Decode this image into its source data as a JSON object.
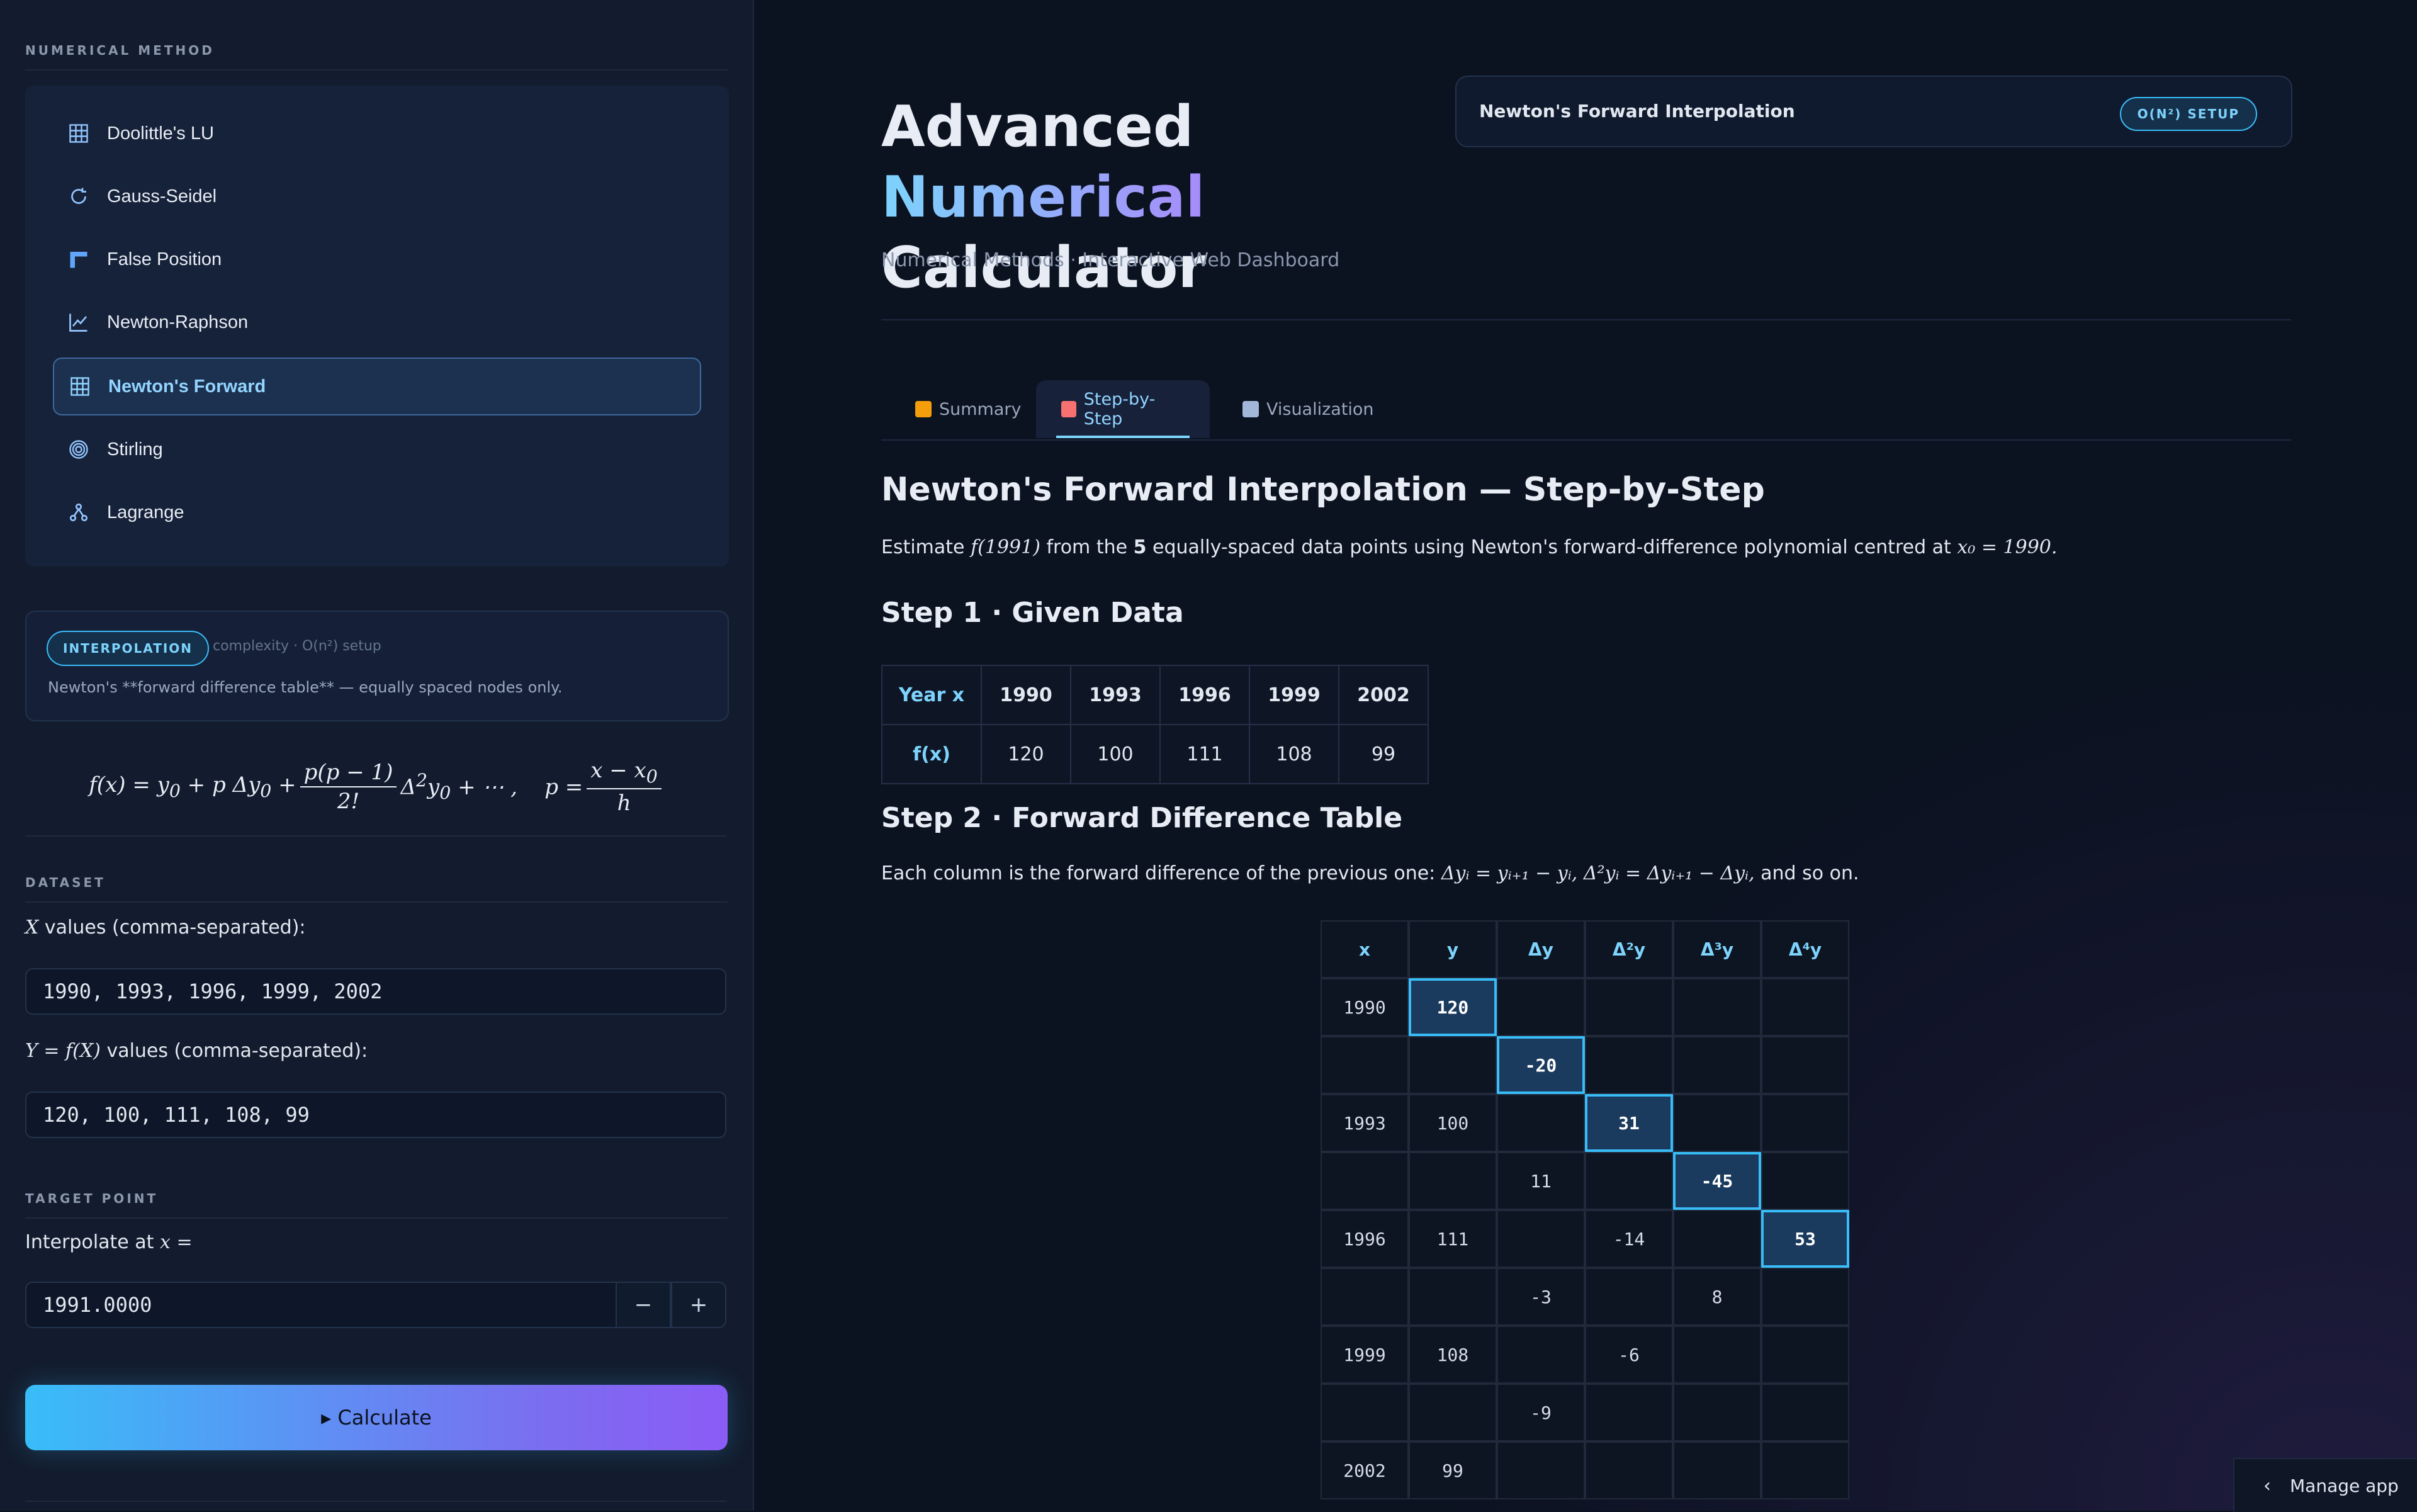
{
  "sidebar": {
    "method_header": "NUMERICAL METHOD",
    "methods": [
      {
        "label": "Doolittle's LU",
        "icon": "grid-icon"
      },
      {
        "label": "Gauss-Seidel",
        "icon": "refresh-icon"
      },
      {
        "label": "False Position",
        "icon": "ruler-icon"
      },
      {
        "label": "Newton-Raphson",
        "icon": "line-chart-icon"
      },
      {
        "label": "Newton's Forward",
        "icon": "table-icon"
      },
      {
        "label": "Stirling",
        "icon": "target-icon"
      },
      {
        "label": "Lagrange",
        "icon": "network-icon"
      }
    ],
    "active_method": "Newton's Forward",
    "info": {
      "badge": "INTERPOLATION",
      "complexity": "complexity · O(n²) setup",
      "description": "Newton's **forward difference table** — equally spaced nodes only."
    },
    "dataset_header": "DATASET",
    "x_label": "values (comma-separated):",
    "x_label_var": "X",
    "x_value": "1990, 1993, 1996, 1999, 2002",
    "y_label": "values (comma-separated):",
    "y_label_var": "Y = f(X)",
    "y_value": "120, 100, 111, 108, 99",
    "target_header": "TARGET POINT",
    "target_label": "Interpolate at",
    "target_var": "x =",
    "target_value": "1991.0000",
    "minus": "−",
    "plus": "+",
    "calculate": "▸ Calculate"
  },
  "header": {
    "title_plain": "Advanced",
    "title_grad": "Numerical",
    "title_line2": "Calculator",
    "subtitle": "Numerical Methods · Interactive Web Dashboard",
    "card_title": "Newton's Forward Interpolation",
    "card_badge": "O(N²) SETUP"
  },
  "tabs": [
    {
      "label": "Summary",
      "color": "#f59e0b"
    },
    {
      "label": "Step-by-Step",
      "color": "#f87171"
    },
    {
      "label": "Visualization",
      "color": "#a3b8d8"
    }
  ],
  "active_tab": "Step-by-Step",
  "content": {
    "heading": "Newton's Forward Interpolation — Step-by-Step",
    "intro_pre": "Estimate",
    "intro_fx": "f(1991)",
    "intro_mid": "from the",
    "intro_n": "5",
    "intro_post": "equally-spaced data points using Newton's forward-difference polynomial centred at",
    "intro_x0": "x₀ = 1990.",
    "step1": "Step 1 · Given Data",
    "given": {
      "row1_label": "Year x",
      "row2_label": "f(x)",
      "x": [
        "1990",
        "1993",
        "1996",
        "1999",
        "2002"
      ],
      "y": [
        "120",
        "100",
        "111",
        "108",
        "99"
      ]
    },
    "step2": "Step 2 · Forward Difference Table",
    "step2_pre": "Each column is the forward difference of the previous one:",
    "step2_eq1": "Δyᵢ = yᵢ₊₁ − yᵢ,",
    "step2_eq2": "Δ²yᵢ = Δyᵢ₊₁ − Δyᵢ,",
    "step2_post": "and so on.",
    "diff_headers": [
      "x",
      "y",
      "Δy",
      "Δ²y",
      "Δ³y",
      "Δ⁴y"
    ],
    "diff_rows": [
      [
        "1990",
        "120",
        "",
        "",
        "",
        ""
      ],
      [
        "",
        "",
        "-20",
        "",
        "",
        ""
      ],
      [
        "1993",
        "100",
        "",
        "31",
        "",
        ""
      ],
      [
        "",
        "",
        "11",
        "",
        "-45",
        ""
      ],
      [
        "1996",
        "111",
        "",
        "-14",
        "",
        "53"
      ],
      [
        "",
        "",
        "-3",
        "",
        "8",
        ""
      ],
      [
        "1999",
        "108",
        "",
        "-6",
        "",
        ""
      ],
      [
        "",
        "",
        "-9",
        "",
        "",
        ""
      ],
      [
        "2002",
        "99",
        "",
        "",
        "",
        ""
      ]
    ],
    "highlight_cells": [
      [
        0,
        1
      ],
      [
        1,
        2
      ],
      [
        2,
        3
      ],
      [
        3,
        4
      ],
      [
        4,
        5
      ]
    ]
  },
  "manage_app": "Manage app",
  "colors": {
    "accent": "#38bdf8",
    "accent2": "#8b5cf6",
    "bg": "#0b1220"
  }
}
